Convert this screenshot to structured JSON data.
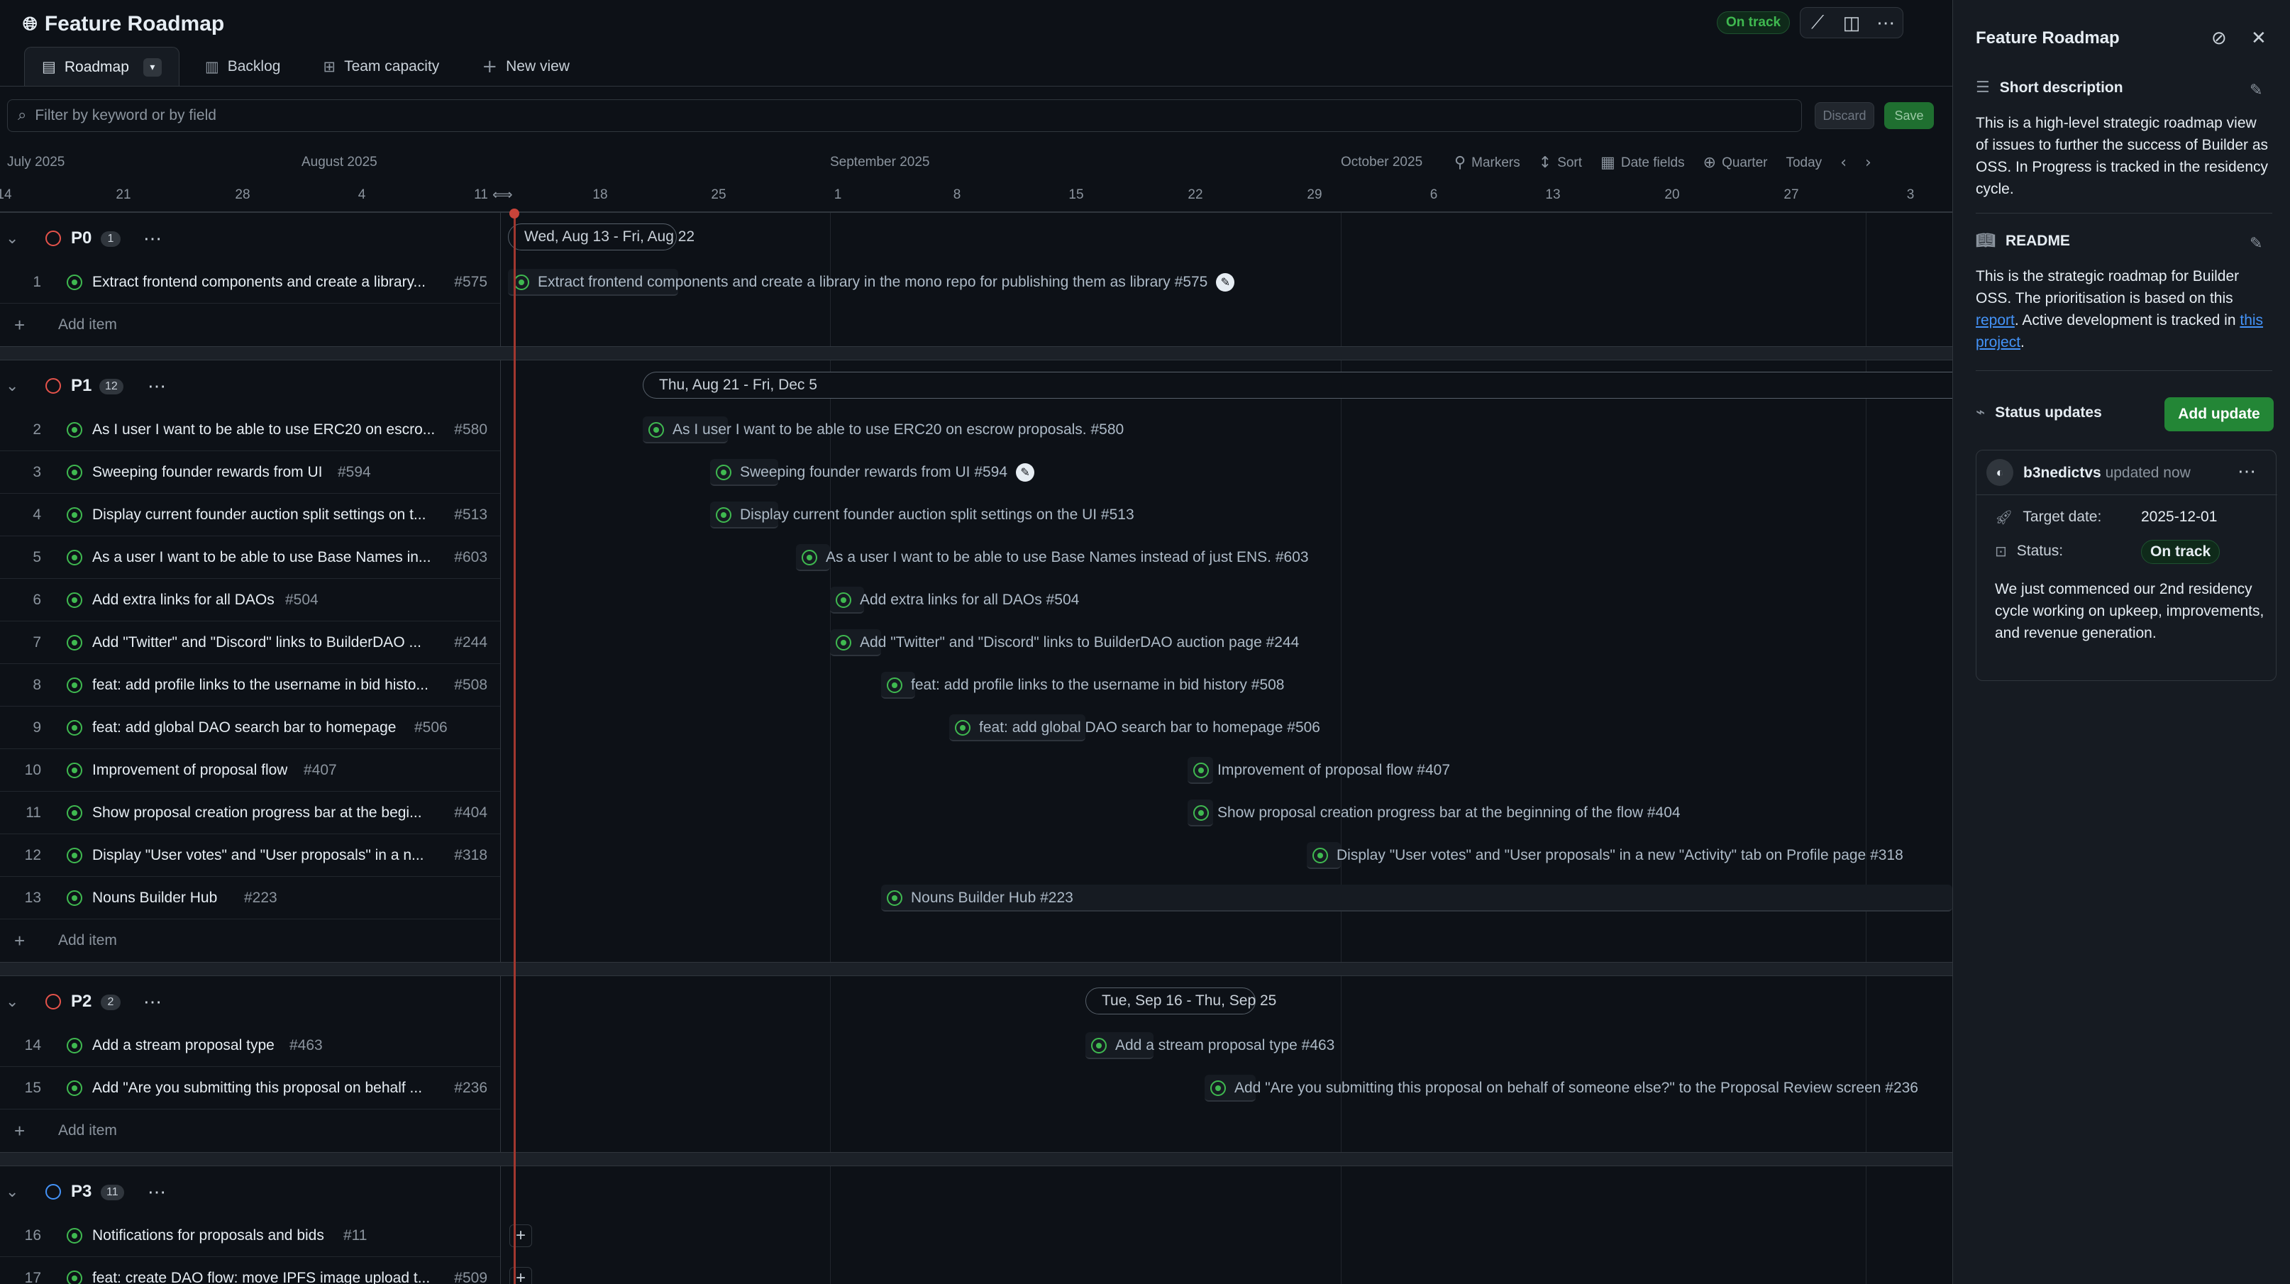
{
  "header": {
    "title": "Feature Roadmap",
    "status_badge": "On track"
  },
  "tabs": [
    {
      "label": "Roadmap",
      "active": true
    },
    {
      "label": "Backlog"
    },
    {
      "label": "Team capacity"
    },
    {
      "label": "New view"
    }
  ],
  "filter": {
    "placeholder": "Filter by keyword or by field",
    "discard": "Discard",
    "save": "Save"
  },
  "timeline": {
    "months": [
      "July 2025",
      "August 2025",
      "September 2025",
      "October 2025"
    ],
    "days": [
      "14",
      "21",
      "28",
      "4",
      "11",
      "18",
      "25",
      "1",
      "8",
      "15",
      "22",
      "29",
      "6",
      "13",
      "20",
      "27",
      "3"
    ],
    "controls": {
      "markers": "Markers",
      "sort": "Sort",
      "date_fields": "Date fields",
      "zoom": "Quarter",
      "today": "Today"
    }
  },
  "groups": [
    {
      "name": "P0",
      "count": "1",
      "range": "Wed, Aug 13 - Fri, Aug 22",
      "items": [
        {
          "num": "1",
          "title": "Extract frontend components and create a library...",
          "issue": "#575",
          "bar": "Extract frontend components and create a library in the mono repo for publishing them as library #575"
        }
      ]
    },
    {
      "name": "P1",
      "count": "12",
      "range": "Thu, Aug 21 - Fri, Dec 5",
      "items": [
        {
          "num": "2",
          "title": "As I user I want to be able to use ERC20 on escro...",
          "issue": "#580",
          "bar": "As I user I want to be able to use ERC20 on escrow proposals. #580"
        },
        {
          "num": "3",
          "title": "Sweeping founder rewards from UI",
          "issue": "#594",
          "bar": "Sweeping founder rewards from UI #594"
        },
        {
          "num": "4",
          "title": "Display current founder auction split settings on t...",
          "issue": "#513",
          "bar": "Display current founder auction split settings on the UI #513"
        },
        {
          "num": "5",
          "title": "As a user I want to be able to use Base Names in...",
          "issue": "#603",
          "bar": "As a user I want to be able to use Base Names instead of just ENS. #603"
        },
        {
          "num": "6",
          "title": "Add extra links for all DAOs",
          "issue": "#504",
          "bar": "Add extra links for all DAOs #504"
        },
        {
          "num": "7",
          "title": "Add \"Twitter\" and \"Discord\" links to BuilderDAO ...",
          "issue": "#244",
          "bar": "Add \"Twitter\" and \"Discord\" links to BuilderDAO auction page #244"
        },
        {
          "num": "8",
          "title": "feat: add profile links to the username in bid histo...",
          "issue": "#508",
          "bar": "feat: add profile links to the username in bid history #508"
        },
        {
          "num": "9",
          "title": "feat: add global DAO search bar to homepage",
          "issue": "#506",
          "bar": "feat: add global DAO search bar to homepage #506"
        },
        {
          "num": "10",
          "title": "Improvement of proposal flow",
          "issue": "#407",
          "bar": "Improvement of proposal flow #407"
        },
        {
          "num": "11",
          "title": "Show proposal creation progress bar at the begi...",
          "issue": "#404",
          "bar": "Show proposal creation progress bar at the beginning of the flow #404"
        },
        {
          "num": "12",
          "title": "Display \"User votes\" and \"User proposals\" in a n...",
          "issue": "#318",
          "bar": "Display \"User votes\" and \"User proposals\" in a new \"Activity\" tab on Profile page #318"
        },
        {
          "num": "13",
          "title": "Nouns Builder Hub",
          "issue": "#223",
          "bar": "Nouns Builder Hub #223"
        }
      ]
    },
    {
      "name": "P2",
      "count": "2",
      "range": "Tue, Sep 16 - Thu, Sep 25",
      "items": [
        {
          "num": "14",
          "title": "Add a stream proposal type",
          "issue": "#463",
          "bar": "Add a stream proposal type #463"
        },
        {
          "num": "15",
          "title": "Add \"Are you submitting this proposal on behalf ...",
          "issue": "#236",
          "bar": "Add \"Are you submitting this proposal on behalf of someone else?\" to the Proposal Review screen #236"
        }
      ]
    },
    {
      "name": "P3",
      "count": "11",
      "items": [
        {
          "num": "16",
          "title": "Notifications for proposals and bids",
          "issue": "#11"
        },
        {
          "num": "17",
          "title": "feat: create DAO flow: move IPFS image upload t...",
          "issue": "#509"
        }
      ]
    }
  ],
  "add_item_label": "Add item",
  "panel": {
    "title": "Feature Roadmap",
    "short_description": {
      "heading": "Short description",
      "text": "This is a high-level strategic roadmap view of issues to further the success of Builder as OSS. In Progress is tracked in the residency cycle."
    },
    "readme": {
      "heading": "README",
      "text_1": "This is the strategic roadmap for Builder OSS. The prioritisation is based on this ",
      "link_1": "report",
      "text_2": ". Active development is tracked in ",
      "link_2": "this project",
      "text_3": "."
    },
    "status_updates": {
      "heading": "Status updates",
      "add_button": "Add update",
      "author": "b3nedictvs",
      "when": "updated now",
      "target_label": "Target date:",
      "target_value": "2025-12-01",
      "status_label": "Status:",
      "status_value": "On track",
      "body": "We just commenced our 2nd residency cycle working on upkeep, improvements, and revenue generation."
    }
  },
  "colors": {
    "accent_green": "#238636",
    "ontrack_green": "#3fb950",
    "today_red": "#a1372f",
    "p_red": "#e5534b",
    "p3_blue": "#4493f8"
  }
}
